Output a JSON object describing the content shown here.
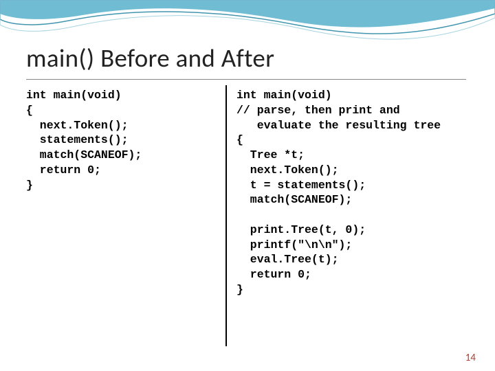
{
  "title": "main() Before and After",
  "code_left": "int main(void)\n{\n  next.Token();\n  statements();\n  match(SCANEOF);\n  return 0;\n}",
  "code_right": "int main(void)\n// parse, then print and\n   evaluate the resulting tree\n{\n  Tree *t;\n  next.Token();\n  t = statements();\n  match(SCANEOF);\n\n  print.Tree(t, 0);\n  printf(\"\\n\\n\");\n  eval.Tree(t);\n  return 0;\n}",
  "page_number": "14"
}
